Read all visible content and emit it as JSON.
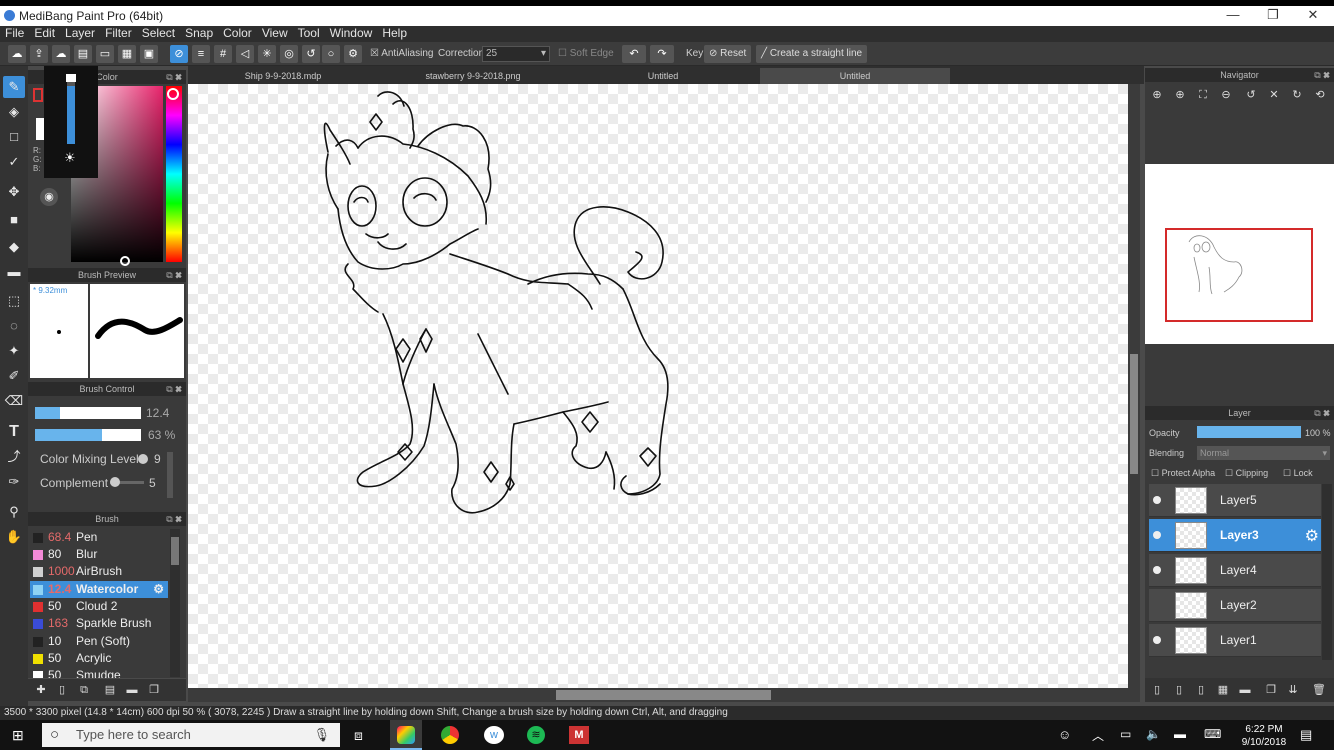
{
  "window": {
    "title": "MediBang Paint Pro (64bit)",
    "min": "—",
    "restore": "❐",
    "close": "✕"
  },
  "menu": [
    "File",
    "Edit",
    "Layer",
    "Filter",
    "Select",
    "Snap",
    "Color",
    "View",
    "Tool",
    "Window",
    "Help"
  ],
  "toolbar": {
    "antialiasing_label": "AntiAliasing",
    "correction_label": "Correction",
    "correction_value": "25",
    "soft_edge_label": "Soft Edge",
    "key_label": "Key",
    "reset_label": "Reset",
    "straight_line_label": "Create a straight line"
  },
  "tabs": [
    "Ship 9-9-2018.mdp",
    "stawberry 9-9-2018.png",
    "Untitled",
    "Untitled"
  ],
  "color_panel": {
    "title": "Color",
    "rgb_labels": [
      "R:",
      "G:",
      "B:"
    ]
  },
  "brush_preview": {
    "title": "Brush Preview",
    "size_text": "* 9.32mm"
  },
  "brush_control": {
    "title": "Brush Control",
    "size_value": "12.4",
    "opacity_value": "63 %",
    "color_mixing_label": "Color Mixing Level",
    "color_mixing_value": "9",
    "complement_label": "Complement",
    "complement_value": "5"
  },
  "brush_panel": {
    "title": "Brush",
    "items": [
      {
        "size": "68.4",
        "name": "Pen",
        "color": "#222222"
      },
      {
        "size": "80",
        "name": "Blur",
        "color": "#f48ad8"
      },
      {
        "size": "1000",
        "name": "AirBrush",
        "color": "#d0d0d0"
      },
      {
        "size": "12.4",
        "name": "Watercolor",
        "color": "#8fd3f5"
      },
      {
        "size": "50",
        "name": "Cloud 2",
        "color": "#e03030"
      },
      {
        "size": "163",
        "name": "Sparkle Brush",
        "color": "#3a4cd8"
      },
      {
        "size": "10",
        "name": "Pen (Soft)",
        "color": "#222222"
      },
      {
        "size": "50",
        "name": "Acrylic",
        "color": "#f0e000"
      },
      {
        "size": "50",
        "name": "Smudge",
        "color": "#ffffff"
      }
    ]
  },
  "navigator": {
    "title": "Navigator"
  },
  "layer_panel": {
    "title": "Layer",
    "opacity_label": "Opacity",
    "opacity_value": "100 %",
    "blending_label": "Blending",
    "blending_value": "Normal",
    "protect_alpha": "Protect Alpha",
    "clipping": "Clipping",
    "lock": "Lock",
    "layers": [
      "Layer5",
      "Layer3",
      "Layer4",
      "Layer2",
      "Layer1"
    ]
  },
  "status": {
    "text": "3500 * 3300 pixel  (14.8 * 14cm)  600 dpi  50 %  ( 3078, 2245 )  Draw a straight line by holding down Shift, Change a brush size by holding down Ctrl, Alt, and dragging"
  },
  "taskbar": {
    "search_placeholder": "Type here to search",
    "time": "6:22 PM",
    "date": "9/10/2018"
  },
  "colors": {
    "accent": "#3d8fd9",
    "panel": "#3a3a3a",
    "dark": "#2b2b2b"
  }
}
